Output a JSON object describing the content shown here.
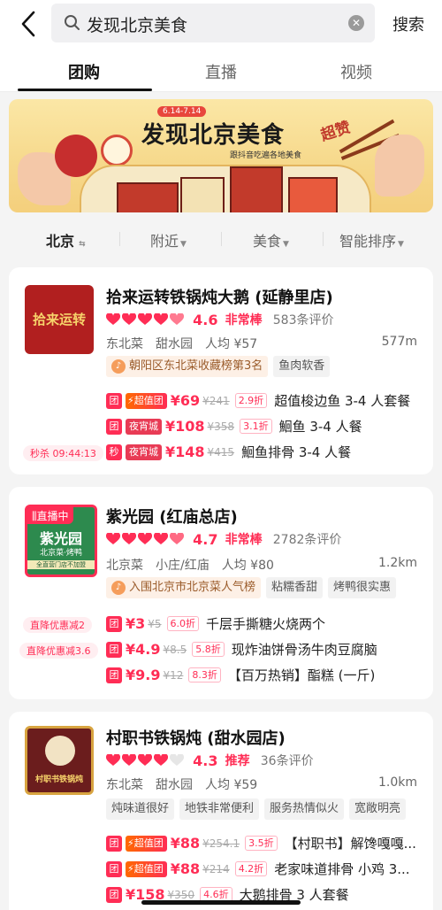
{
  "search": {
    "query": "发现北京美食",
    "button": "搜索"
  },
  "tabs": [
    "团购",
    "直播",
    "视频"
  ],
  "banner": {
    "date_range": "6.14-7.14",
    "title": "发现北京美食",
    "subtitle": "跟抖音吃遍各地美食",
    "super": "超赞"
  },
  "filters": {
    "city": "北京",
    "nearby": "附近",
    "category": "美食",
    "sort": "智能排序"
  },
  "colors": {
    "accent": "#ff2d55",
    "banner_bg": "#f6d88a"
  },
  "cards": [
    {
      "name": "拾来运转铁锅炖大鹅 (延静里店)",
      "thumb_text": "拾来运转",
      "rating_hearts": 5,
      "score": "4.6",
      "score_label": "非常棒",
      "reviews": "583条评价",
      "category": "东北菜",
      "area": "甜水园",
      "avg_price": "人均 ¥57",
      "distance": "577m",
      "tags": [
        "朝阳区东北菜收藏榜第3名",
        "鱼肉软香"
      ],
      "deals": [
        {
          "kind": "团",
          "badge": "超值团",
          "price": "¥69",
          "orig": "¥241",
          "disc": "2.9折",
          "name": "超值梭边鱼 3-4 人套餐"
        },
        {
          "kind": "团",
          "badge": "夜宵城",
          "price": "¥108",
          "orig": "¥358",
          "disc": "3.1折",
          "name": "鮰鱼 3-4 人餐"
        },
        {
          "kind": "秒",
          "badge": "夜宵城",
          "price": "¥148",
          "orig": "¥415",
          "disc": "",
          "name": "鮰鱼排骨 3-4 人餐",
          "side": "秒杀 09:44:13"
        }
      ]
    },
    {
      "name": "紫光园 (红庙总店)",
      "thumb_text": "紫光园",
      "thumb_sub": "北京菜·烤鸭",
      "thumb_note": "全直营门店不加盟",
      "live_label": "直播中",
      "rating_hearts": 5,
      "score": "4.7",
      "score_label": "非常棒",
      "reviews": "2782条评价",
      "category": "北京菜",
      "area": "小庄/红庙",
      "avg_price": "人均 ¥80",
      "distance": "1.2km",
      "tags": [
        "入围北京市北京菜人气榜",
        "粘糯香甜",
        "烤鸭很实惠"
      ],
      "deals": [
        {
          "kind": "团",
          "badge": "",
          "price": "¥3",
          "orig": "¥5",
          "disc": "6.0折",
          "name": "千层手撕糖火烧两个",
          "side": "直降优惠减2"
        },
        {
          "kind": "团",
          "badge": "",
          "price": "¥4.9",
          "orig": "¥8.5",
          "disc": "5.8折",
          "name": "现炸油饼骨汤牛肉豆腐脑",
          "side": "直降优惠减3.6"
        },
        {
          "kind": "团",
          "badge": "",
          "price": "¥9.9",
          "orig": "¥12",
          "disc": "8.3折",
          "name": "【百万热销】酯糕 (一斤)"
        }
      ]
    },
    {
      "name": "村职书铁锅炖 (甜水园店)",
      "thumb_text": "村职书铁锅炖",
      "rating_hearts": 4,
      "score": "4.3",
      "score_label": "推荐",
      "reviews": "36条评价",
      "category": "东北菜",
      "area": "甜水园",
      "avg_price": "人均 ¥59",
      "distance": "1.0km",
      "tags": [
        "炖味道很好",
        "地铁非常便利",
        "服务热情似火",
        "宽敞明亮"
      ],
      "deals": [
        {
          "kind": "团",
          "badge": "超值团",
          "price": "¥88",
          "orig": "¥254.1",
          "disc": "3.5折",
          "name": "【村职书】解馋嘎嘎..."
        },
        {
          "kind": "团",
          "badge": "超值团",
          "price": "¥88",
          "orig": "¥214",
          "disc": "4.2折",
          "name": "老家味道排骨 小鸡 3..."
        },
        {
          "kind": "团",
          "badge": "",
          "price": "¥158",
          "orig": "¥350",
          "disc": "4.6折",
          "name": "大鹅排骨 3 人套餐"
        }
      ]
    }
  ]
}
